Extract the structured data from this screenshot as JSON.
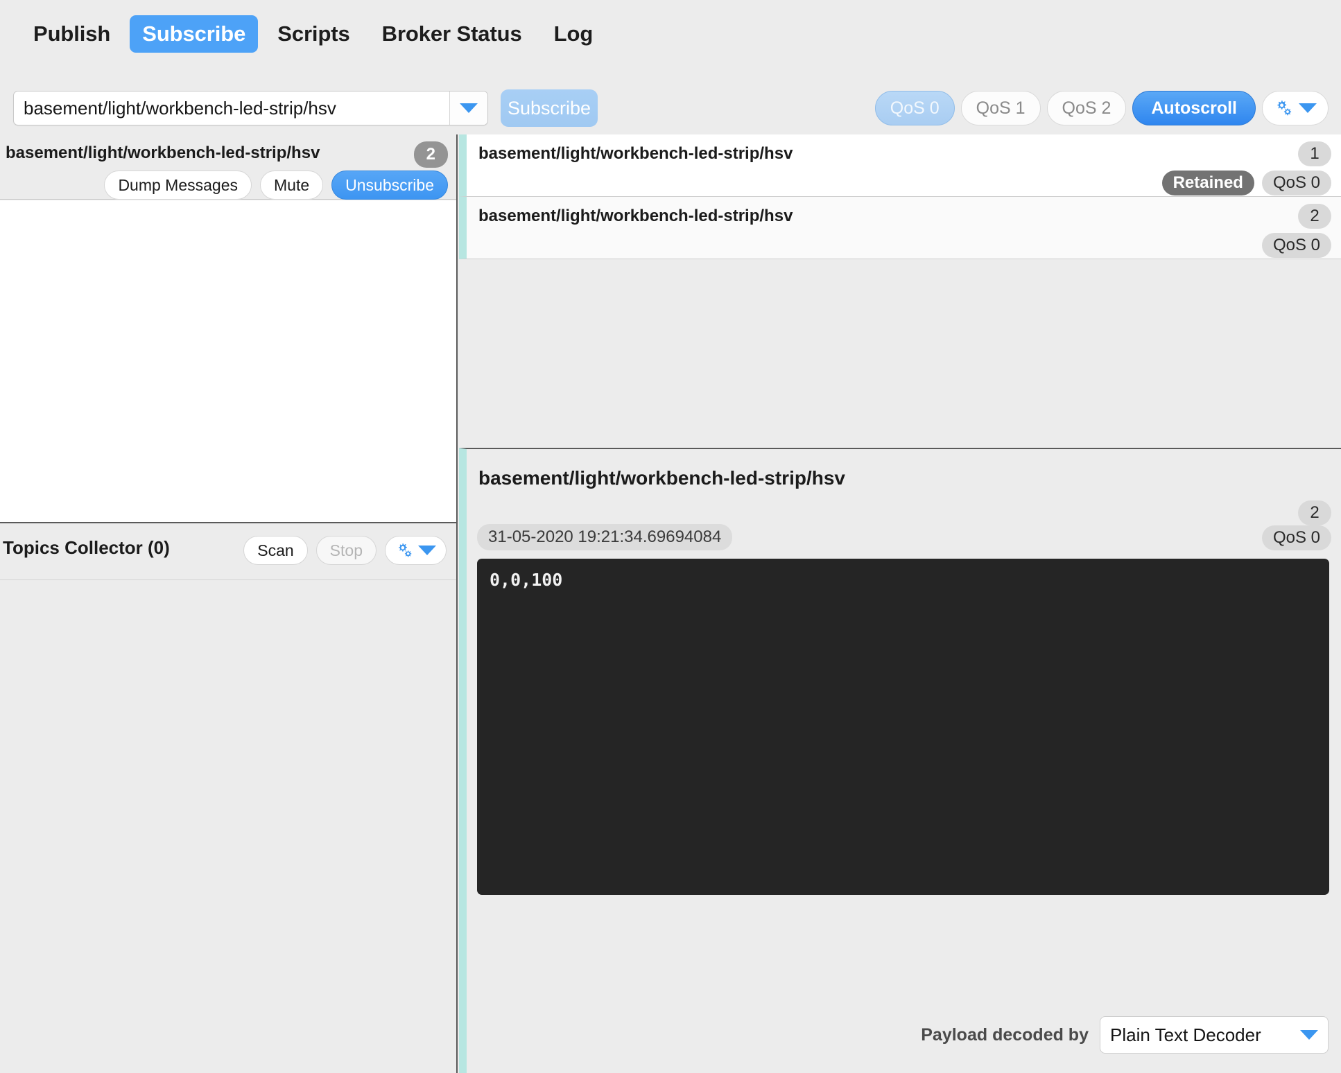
{
  "tabs": [
    {
      "label": "Publish",
      "active": false
    },
    {
      "label": "Subscribe",
      "active": true
    },
    {
      "label": "Scripts",
      "active": false
    },
    {
      "label": "Broker Status",
      "active": false
    },
    {
      "label": "Log",
      "active": false
    }
  ],
  "toolbar": {
    "topic_value": "basement/light/workbench-led-strip/hsv",
    "topic_placeholder": "Topic",
    "subscribe_label": "Subscribe",
    "qos0_label": "QoS 0",
    "qos1_label": "QoS 1",
    "qos2_label": "QoS 2",
    "autoscroll_label": "Autoscroll",
    "selected_qos": "QoS 0",
    "autoscroll_on": true,
    "accent_blue": "#3d95f2",
    "accent_blue_light": "#a8cff5"
  },
  "subscriptions": {
    "topic": "basement/light/workbench-led-strip/hsv",
    "count": "2",
    "dump_label": "Dump Messages",
    "mute_label": "Mute",
    "unsubscribe_label": "Unsubscribe"
  },
  "collector": {
    "title": "Topics Collector (0)",
    "scan_label": "Scan",
    "stop_label": "Stop"
  },
  "messages": [
    {
      "topic": "basement/light/workbench-led-strip/hsv",
      "number": "1",
      "retained_label": "Retained",
      "retained": true,
      "qos": "QoS 0"
    },
    {
      "topic": "basement/light/workbench-led-strip/hsv",
      "number": "2",
      "retained": false,
      "qos": "QoS 0"
    }
  ],
  "detail": {
    "topic": "basement/light/workbench-led-strip/hsv",
    "number": "2",
    "timestamp": "31-05-2020  19:21:34.69694084",
    "qos": "QoS 0",
    "payload": "0,0,100",
    "decoder_label": "Payload decoded by",
    "decoder_value": "Plain Text Decoder",
    "accent_teal": "#b7e6e1"
  }
}
